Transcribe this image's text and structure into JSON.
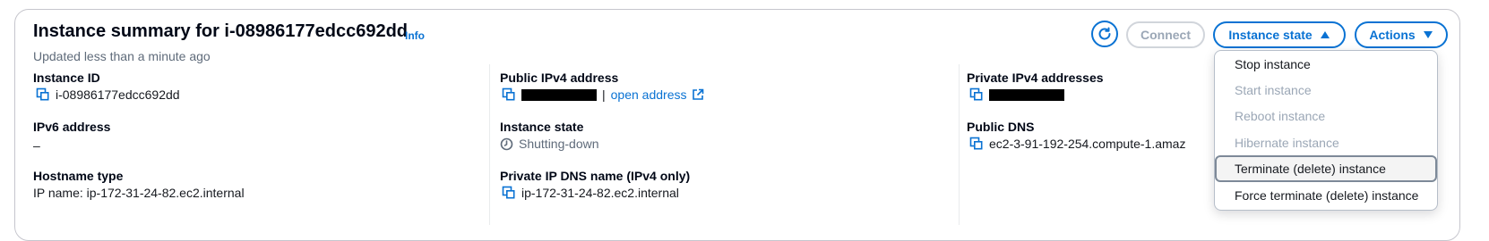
{
  "header": {
    "title": "Instance summary for i-08986177edcc692dd",
    "info_label": "Info",
    "subtitle": "Updated less than a minute ago"
  },
  "toolbar": {
    "refresh_icon": "refresh-icon",
    "connect_label": "Connect",
    "instance_state_label": "Instance state",
    "actions_label": "Actions"
  },
  "fields": {
    "instance_id_label": "Instance ID",
    "instance_id_value": "i-08986177edcc692dd",
    "ipv6_label": "IPv6 address",
    "ipv6_value": "–",
    "hostname_type_label": "Hostname type",
    "hostname_type_value": "IP name: ip-172-31-24-82.ec2.internal",
    "public_ipv4_label": "Public IPv4 address",
    "public_ipv4_separator": "|",
    "open_address_label": "open address",
    "instance_state_label": "Instance state",
    "instance_state_value": "Shutting-down",
    "private_dns_label": "Private IP DNS name (IPv4 only)",
    "private_dns_value": "ip-172-31-24-82.ec2.internal",
    "private_ipv4_label": "Private IPv4 addresses",
    "public_dns_label": "Public DNS",
    "public_dns_value": "ec2-3-91-192-254.compute-1.amaz"
  },
  "instance_state_menu": {
    "items": [
      {
        "label": "Stop instance",
        "enabled": true
      },
      {
        "label": "Start instance",
        "enabled": false
      },
      {
        "label": "Reboot instance",
        "enabled": false
      },
      {
        "label": "Hibernate instance",
        "enabled": false
      },
      {
        "label": "Terminate (delete) instance",
        "enabled": true,
        "highlighted": true
      },
      {
        "label": "Force terminate (delete) instance",
        "enabled": true
      }
    ]
  },
  "colors": {
    "accent": "#0972d3",
    "disabled": "#9ba7b6",
    "border": "#c6c6cd"
  }
}
